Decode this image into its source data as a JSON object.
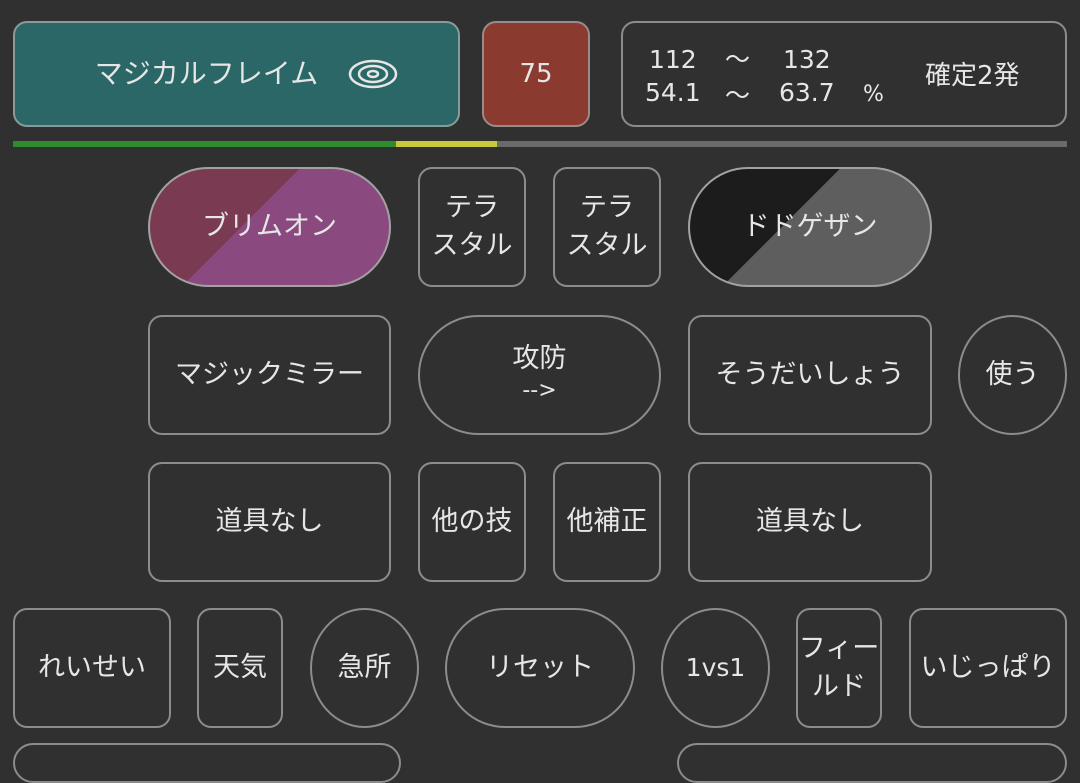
{
  "move": {
    "name": "マジカルフレイム",
    "icon": "special-move-icon"
  },
  "power": "75",
  "damage": {
    "min": "112",
    "tilde1": "〜",
    "max": "132",
    "min_percent": "54.1",
    "tilde2": "〜",
    "max_percent": "63.7",
    "percent_sign": "%",
    "result": "確定2発"
  },
  "hp_bar": {
    "green_fraction": 0.363,
    "yellow_fraction": 0.096,
    "colors": {
      "green": "#2e8b2e",
      "yellow": "#c8c83a",
      "rest": "#6a6a6a"
    }
  },
  "attacker": {
    "name": "ブリムオン",
    "tera": [
      "テラ",
      "スタル"
    ],
    "ability": "マジックミラー",
    "item": "道具なし",
    "colors": {
      "left": "#7a3a52",
      "right": "#8a4a80"
    }
  },
  "defender": {
    "name": "ドドゲザン",
    "tera": [
      "テラ",
      "スタル"
    ],
    "ability": "そうだいしょう",
    "item": "道具なし",
    "colors": {
      "left": "#1c1c1c",
      "right": "#5e5e5e"
    }
  },
  "swap": {
    "line1": "攻防",
    "line2": "-->"
  },
  "use_button": "使う",
  "other_move": "他の技",
  "other_modifier": "他補正",
  "bottom_row": {
    "nature": "れいせい",
    "weather": "天気",
    "critical": "急所",
    "reset": "リセット",
    "mode": "1vs1",
    "field": [
      "フィー",
      "ルド"
    ],
    "ability2": "いじっぱり"
  }
}
